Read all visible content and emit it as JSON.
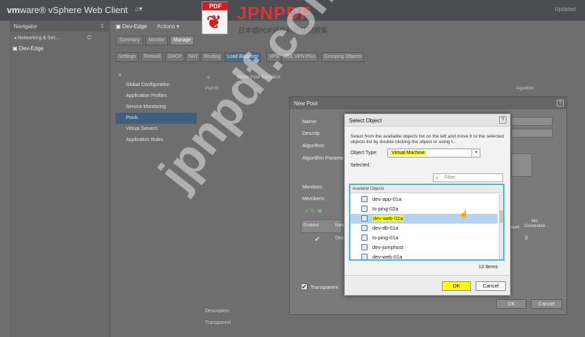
{
  "app": {
    "brand_vm": "vm",
    "brand_rest": "ware® vSphere Web Client",
    "home_icon": "⌂▾",
    "user": "Updated"
  },
  "watermark": {
    "pdf_label": "PDF",
    "logo_text": "JPNPDF",
    "logo_sub": "日本語PDF版無料試験問題集",
    "big_text": "jpnpdf.com"
  },
  "navigator": {
    "title": "Navigator",
    "pin": "‡",
    "back": "◂ Networking & Sec...",
    "history_icon": "⏲",
    "item": "▣ Dev-Edge"
  },
  "object": {
    "title": "▣ Dev-Edge",
    "actions": "Actions ▾",
    "tabs": [
      "Summary",
      "Monitor",
      "Manage"
    ],
    "subtabs": [
      "Settings",
      "Firewall",
      "DHCP",
      "NAT",
      "Routing",
      "Load Balancer",
      "VPN",
      "SSL VPN-Plus",
      "Grouping Objects"
    ]
  },
  "menu": {
    "collapse": "«",
    "items": [
      "Global Configuration",
      "Application Profiles",
      "Service Monitoring",
      "Pools",
      "Virtual Servers",
      "Application Rules"
    ]
  },
  "pools": {
    "add": "+",
    "stats": "Show Pool Statistics",
    "col_id": "Pool ID",
    "col_algo": "Algorithm",
    "desc_label": "Description",
    "transparent_label": "Transparent"
  },
  "new_pool": {
    "title": "New Pool",
    "help": "?",
    "name_label": "Name:",
    "desc_label": "Descrip",
    "algo_label": "Algorithm:",
    "algo_params_label": "Algorithm Parame",
    "monitors_label": "Monitors:",
    "members_label": "Members:",
    "tools": "+ ✎ ✖",
    "col_enabled": "Enabled",
    "col_name": "Nam",
    "row_check": "✔",
    "row_name": "Dev",
    "col_min_conn": "Min Connection",
    "col_min_conn_prefix": "ount",
    "row_min": "0",
    "transparent_check": "✔",
    "transparent": "Transparent",
    "ok": "OK",
    "cancel": "Cancel"
  },
  "select_object": {
    "title": "Select Object",
    "help": "?",
    "description": "Select from the available objects list on the left and move it to the selected objects list by double clicking the object or using t...",
    "object_type_label": "Object Type:",
    "object_type_value": "Virtual Machine",
    "dropdown_arrow": "▾",
    "selected_label": "Selected:",
    "filter_icon": "⌕",
    "filter_placeholder": "Filter",
    "available_label": "Available Objects",
    "items": [
      "dev-app-01a",
      "ts-ping-02a",
      "dev-web-02a",
      "dev-db-01a",
      "ts-ping-01a",
      "dev-jumphost",
      "dev-web-01a"
    ],
    "selected_index": 2,
    "cursor": "☝",
    "count": "12 items",
    "ok": "OK",
    "cancel": "Cancel"
  }
}
